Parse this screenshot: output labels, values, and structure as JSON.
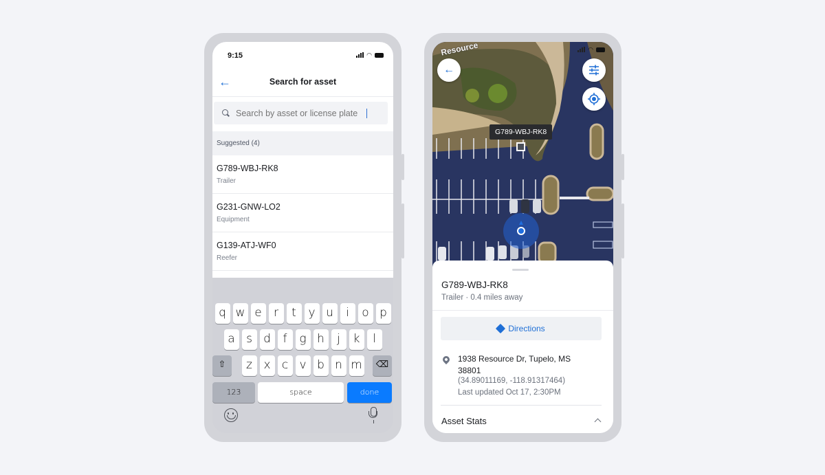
{
  "search_screen": {
    "status": {
      "time": "9:15"
    },
    "nav": {
      "title": "Search for asset",
      "back_icon": "arrow-left-icon"
    },
    "search": {
      "placeholder": "Search by asset or license plate",
      "value": ""
    },
    "suggested_header": "Suggested (4)",
    "suggestions": [
      {
        "id": "G789-WBJ-RK8",
        "type": "Trailer"
      },
      {
        "id": "G231-GNW-LO2",
        "type": "Equipment"
      },
      {
        "id": "G139-ATJ-WF0",
        "type": "Reefer"
      }
    ],
    "keyboard": {
      "row1": [
        "q",
        "w",
        "e",
        "r",
        "t",
        "y",
        "u",
        "i",
        "o",
        "p"
      ],
      "row2": [
        "a",
        "s",
        "d",
        "f",
        "g",
        "h",
        "j",
        "k",
        "l"
      ],
      "row3": [
        "z",
        "x",
        "c",
        "v",
        "b",
        "n",
        "m"
      ],
      "numbers_label": "123",
      "space_label": "space",
      "done_label": "done",
      "accent_color": "#0a7bff"
    }
  },
  "map_screen": {
    "map_street_label": "Resource",
    "asset_tooltip": "G789-WBJ-RK8",
    "sheet": {
      "title": "G789-WBJ-RK8",
      "subtitle": "Trailer · 0.4 miles away",
      "directions_label": "Directions",
      "address": "1938 Resource Dr, Tupelo, MS 38801",
      "coordinates": "(34.89011169, -118.91317464)",
      "last_updated": "Last updated Oct 17, 2:30PM",
      "stats_label": "Asset Stats"
    },
    "accent_color": "#1f6fd6"
  }
}
